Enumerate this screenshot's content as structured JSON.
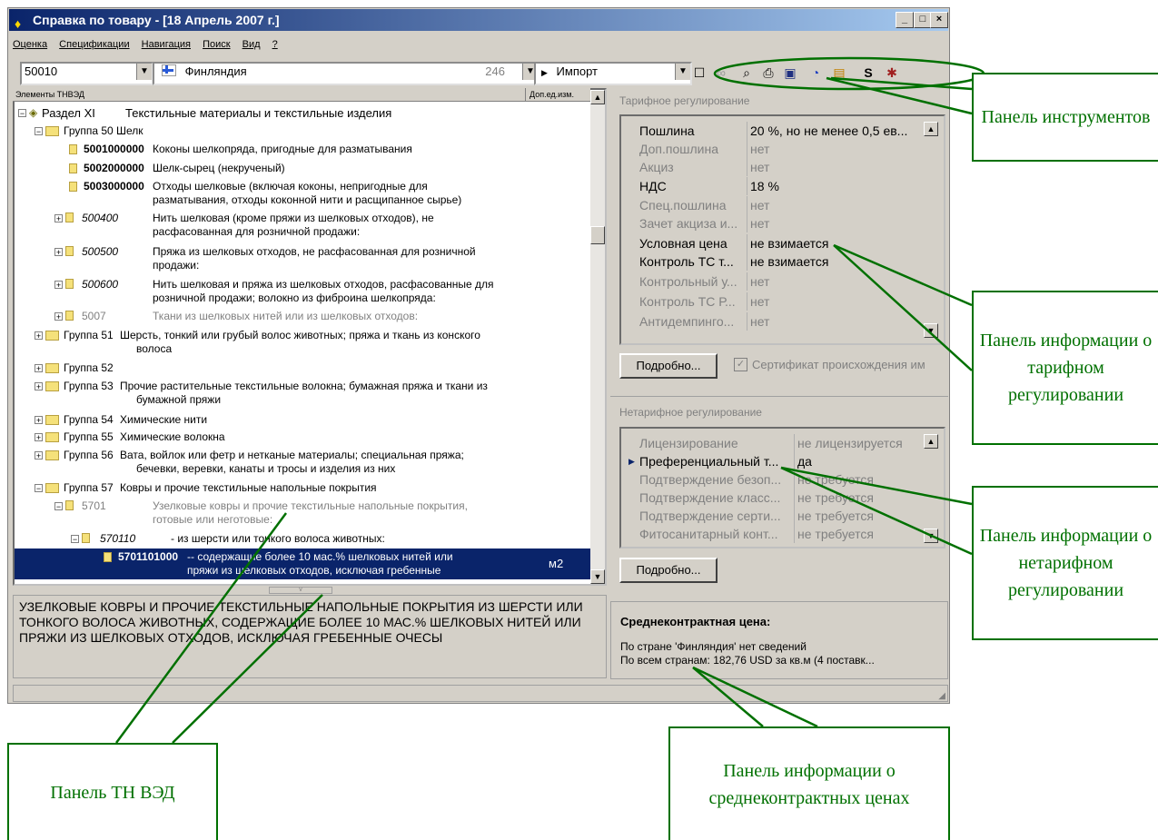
{
  "window": {
    "title": "Справка по товару - [18 Апрель 2007 г.]",
    "buttons": [
      "_",
      "□",
      "×"
    ]
  },
  "menu": [
    "Оценка",
    "Спецификации",
    "Навигация",
    "Поиск",
    "Вид",
    "?"
  ],
  "toolbar": {
    "code": "50010",
    "country": "Финляндия",
    "country_num": "246",
    "mode": "Импорт",
    "icons": [
      "new-doc-icon",
      "link-icon",
      "search-doc-icon",
      "print-icon",
      "copy-icon",
      "clock-icon",
      "calendar-icon",
      "sum-icon",
      "settings-icon"
    ]
  },
  "tree": {
    "col1": "Элементы ТНВЭД",
    "col2": "Доп.ед.изм.",
    "rows": [
      {
        "code": "Раздел XI",
        "text": "Текстильные материалы и текстильные изделия"
      },
      {
        "code": "Группа 50",
        "text": "Шелк"
      },
      {
        "code": "5001000000",
        "text": "Коконы шелкопряда, пригодные для разматывания"
      },
      {
        "code": "5002000000",
        "text": "Шелк-сырец (некрученый)"
      },
      {
        "code": "5003000000",
        "text": "Отходы шелковые (включая коконы, непригодные для",
        "text2": "разматывания, отходы коконной нити и расщипанное сырье)"
      },
      {
        "code": "500400",
        "text": "Нить шелковая (кроме пряжи из шелковых отходов), не",
        "text2": "расфасованная для розничной продажи:"
      },
      {
        "code": "500500",
        "text": "Пряжа из шелковых отходов, не расфасованная для розничной",
        "text2": "продажи:"
      },
      {
        "code": "500600",
        "text": "Нить шелковая и пряжа из шелковых отходов, расфасованные для",
        "text2": "розничной продажи; волокно из фиброина шелкопряда:"
      },
      {
        "code": "5007",
        "text": "Ткани из шелковых нитей или из шелковых отходов:"
      },
      {
        "code": "Группа 51",
        "text": "Шерсть, тонкий или грубый волос животных; пряжа и ткань из конского",
        "text2": "волоса"
      },
      {
        "code": "Группа 52",
        "text": ""
      },
      {
        "code": "Группа 53",
        "text": "Прочие растительные текстильные волокна; бумажная пряжа и ткани из",
        "text2": "бумажной пряжи"
      },
      {
        "code": "Группа 54",
        "text": "Химические нити"
      },
      {
        "code": "Группа 55",
        "text": "Химические волокна"
      },
      {
        "code": "Группа 56",
        "text": "Вата, войлок или фетр и нетканые материалы; специальная пряжа;",
        "text2": "бечевки, веревки, канаты и тросы и изделия из них"
      },
      {
        "code": "Группа 57",
        "text": "Ковры и прочие текстильные напольные покрытия"
      },
      {
        "code": "5701",
        "text": "Узелковые ковры и прочие текстильные напольные покрытия,",
        "text2": "готовые или неготовые:"
      },
      {
        "code": "570110",
        "text": "- из шерсти или тонкого волоса животных:"
      },
      {
        "code": "5701101000",
        "text": "-- содержащие более 10 мас.% шелковых нитей или",
        "text2": "пряжи из шелковых отходов, исключая гребенные",
        "unit": "м2"
      }
    ]
  },
  "description": "УЗЕЛКОВЫЕ КОВРЫ И ПРОЧИЕ ТЕКСТИЛЬНЫЕ НАПОЛЬНЫЕ ПОКРЫТИЯ ИЗ ШЕРСТИ ИЛИ ТОНКОГО ВОЛОСА ЖИВОТНЫХ, СОДЕРЖАЩИЕ БОЛЕЕ 10 МАС.% ШЕЛКОВЫХ НИТЕЙ ИЛИ ПРЯЖИ ИЗ ШЕЛКОВЫХ ОТХОДОВ, ИСКЛЮЧАЯ ГРЕБЕННЫЕ ОЧЕСЫ",
  "tariff": {
    "title": "Тарифное регулирование",
    "rows": [
      {
        "k": "Пошлина",
        "v": "20 %, но не менее 0,5 ев...",
        "active": true
      },
      {
        "k": "Доп.пошлина",
        "v": "нет",
        "active": false
      },
      {
        "k": "Акциз",
        "v": "нет",
        "active": false
      },
      {
        "k": "НДС",
        "v": "18 %",
        "active": true
      },
      {
        "k": "Спец.пошлина",
        "v": "нет",
        "active": false
      },
      {
        "k": "Зачет акциза и...",
        "v": "нет",
        "active": false
      },
      {
        "k": "Условная цена",
        "v": "не взимается",
        "active": true
      },
      {
        "k": "Контроль ТС т...",
        "v": "не взимается",
        "active": true
      },
      {
        "k": "Контрольный у...",
        "v": "нет",
        "active": false
      },
      {
        "k": "Контроль ТС Р...",
        "v": "нет",
        "active": false
      },
      {
        "k": "Антидемпинго...",
        "v": "нет",
        "active": false
      }
    ],
    "button": "Подробно...",
    "checkbox": "Сертификат происхождения им"
  },
  "nontariff": {
    "title": "Нетарифное регулирование",
    "rows": [
      {
        "k": "Лицензирование",
        "v": "не лицензируется",
        "active": false
      },
      {
        "k": "Преференциальный т...",
        "v": "да",
        "active": true
      },
      {
        "k": "Подтверждение безоп...",
        "v": "не требуется",
        "active": false
      },
      {
        "k": "Подтверждение класс...",
        "v": "не требуется",
        "active": false
      },
      {
        "k": "Подтверждение серти...",
        "v": "не требуется",
        "active": false
      },
      {
        "k": "Фитосанитарный конт...",
        "v": "не требуется",
        "active": false
      }
    ],
    "button": "Подробно..."
  },
  "price": {
    "title": "Среднеконтрактная цена:",
    "line1": "По стране 'Финляндия' нет сведений",
    "line2": "По всем странам: 182,76 USD за  кв.м (4 поставк..."
  },
  "callouts": {
    "toolbar": "Панель инструментов",
    "tariff": "Панель информации о тарифном регулировании",
    "nontariff": "Панель информации о нетарифном регулировании",
    "tnved": "Панель ТН ВЭД",
    "price": "Панель информации о среднеконтрактных ценах"
  },
  "colors": {
    "callout": "#007000",
    "selection": "#0a246a",
    "window": "#d4d0c8"
  }
}
